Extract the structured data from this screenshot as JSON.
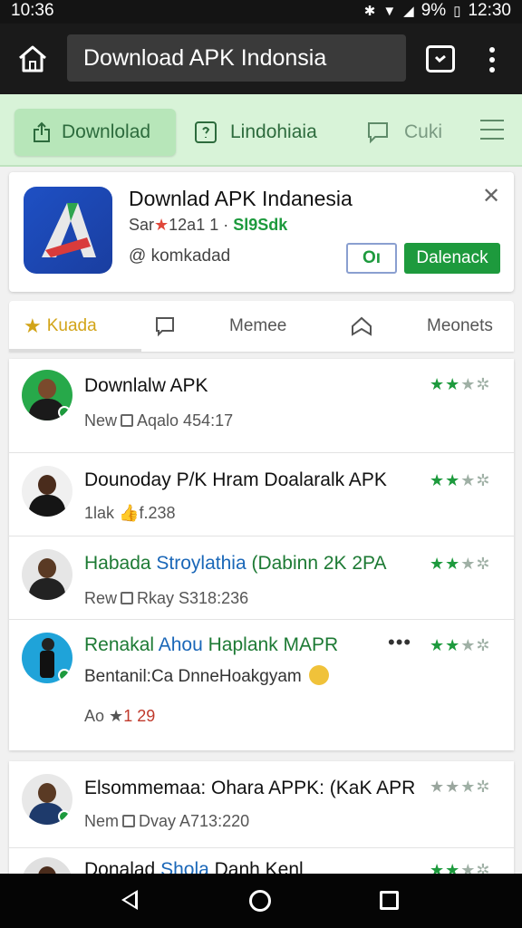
{
  "status_bar": {
    "time": "10:36",
    "battery": "9%",
    "clock": "12:30"
  },
  "browser": {
    "url_text": "Download APK Indonsia"
  },
  "site_nav": {
    "download_label": "Downlolad",
    "indonesia_label": "Lindohiaia",
    "suki_label": "Cuki"
  },
  "app_card": {
    "title": "Downlad APK Indanesia",
    "meta_prefix": "Sar",
    "meta_rating": "12a1",
    "meta_size": "Sl9Sdk",
    "handle": "@ komkadad",
    "small_button": "Oı",
    "download_button": "Dalenack"
  },
  "tabs": [
    {
      "label": "Kuada"
    },
    {
      "label": ""
    },
    {
      "label": "Memee"
    },
    {
      "label": ""
    },
    {
      "label": "Meonets"
    }
  ],
  "list_items": [
    {
      "title": "Downlalw APK",
      "sub_left": "New",
      "sub_right": "Aqalo 454:17",
      "stars_on": 2,
      "stars_off": 2
    },
    {
      "title": "Dounoday P/K Hram Doalaralk APK",
      "sub_left": "1lak",
      "sub_right": "f.238",
      "stars_on": 2,
      "stars_off": 2
    },
    {
      "title_part1": "Habada",
      "title_part2": "Stroylathia",
      "title_part3": "(Dabinn 2K 2PA",
      "sub_left": "Rew",
      "sub_right": "Rkay S318:236",
      "stars_on": 2,
      "stars_off": 2
    },
    {
      "title_part1": "Renakal",
      "title_part2": "Ahou",
      "title_part3": "Haplank MAPR",
      "description": "Bentanil:Ca DnneHoakgyam",
      "rating_prefix": "Ao",
      "rating_value": "1 29",
      "stars_on": 2,
      "stars_off": 2
    }
  ],
  "list_items_2": [
    {
      "title": "Elsommemaa: Ohara APPK: (KaK APR",
      "sub_left": "Nem",
      "sub_right": "Dvay A713:220",
      "stars_on": 2,
      "stars_off": 2
    },
    {
      "title_part1": "Donalad",
      "title_part2": "Shola",
      "title_part3": "Danh Kenl"
    }
  ],
  "colors": {
    "accent_green": "#1d9a3d",
    "nav_background": "#d8f3d8",
    "browser_bar": "#1a1a1a"
  }
}
